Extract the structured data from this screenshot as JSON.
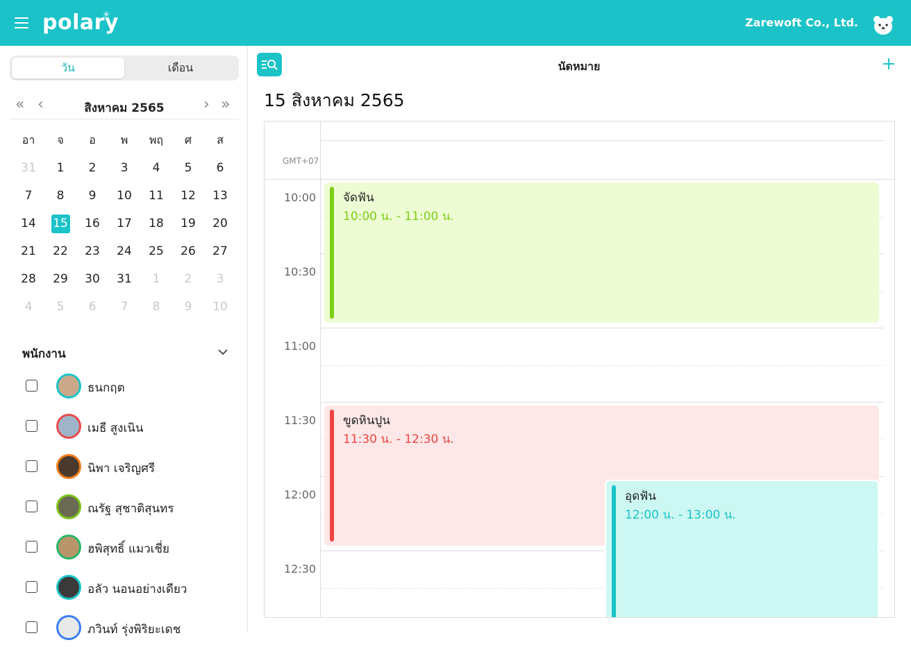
{
  "header": {
    "logo": "polary",
    "company": "Zarewoft Co., Ltd."
  },
  "view_toggle": {
    "day": "วัน",
    "month": "เดือน",
    "active": "day"
  },
  "calendar": {
    "month_label": "สิงหาคม 2565",
    "weekdays": [
      "อา",
      "จ",
      "อ",
      "พ",
      "พฤ",
      "ศ",
      "ส"
    ],
    "weeks": [
      [
        "31",
        "1",
        "2",
        "3",
        "4",
        "5",
        "6"
      ],
      [
        "7",
        "8",
        "9",
        "10",
        "11",
        "12",
        "13"
      ],
      [
        "14",
        "15",
        "16",
        "17",
        "18",
        "19",
        "20"
      ],
      [
        "21",
        "22",
        "23",
        "24",
        "25",
        "26",
        "27"
      ],
      [
        "28",
        "29",
        "30",
        "31",
        "1",
        "2",
        "3"
      ],
      [
        "4",
        "5",
        "6",
        "7",
        "8",
        "9",
        "10"
      ]
    ],
    "selected_day": "15"
  },
  "staff": {
    "title": "พนักงาน",
    "members": [
      {
        "name": "ธนกฤต",
        "ring": "#1bc3c8",
        "fill": "#c9a98a"
      },
      {
        "name": "เมธี สูงเนิน",
        "ring": "#e84a4a",
        "fill": "#9fb4c8"
      },
      {
        "name": "นิพา เจริญศรี",
        "ring": "#f07d1e",
        "fill": "#4a3a2e"
      },
      {
        "name": "ณรัฐ สุชาติสุนทร",
        "ring": "#7cc21c",
        "fill": "#6a6a52"
      },
      {
        "name": "ฮพิสุทธิ์ แมวเชี่ย",
        "ring": "#2bb56a",
        "fill": "#b8966a"
      },
      {
        "name": "อลัว นอนอย่างเดียว",
        "ring": "#1bc3c8",
        "fill": "#3a3a3a"
      },
      {
        "name": "ภวินท์ รุ่งพิริยะเดช",
        "ring": "#3a7ff0",
        "fill": "#e9e9e9"
      }
    ]
  },
  "main": {
    "title": "นัดหมาย",
    "date_title": "15 สิงหาคม 2565",
    "timezone": "GMT+07",
    "time_labels": [
      "10:00",
      "10:30",
      "11:00",
      "11:30",
      "12:00",
      "12:30"
    ]
  },
  "events": [
    {
      "title": "จัดฟัน",
      "time": "10:00 น. - 11:00 น.",
      "color": "#7ccf14",
      "bg": "#eefcd4"
    },
    {
      "title": "ขูดหินปูน",
      "time": "11:30 น. - 12:30 น.",
      "color": "#ef4444",
      "bg": "#fde7e7"
    },
    {
      "title": "อุดฟัน",
      "time": "12:00 น. - 13:00 น.",
      "color": "#1bc3c8",
      "bg": "#cdf7f2"
    }
  ]
}
